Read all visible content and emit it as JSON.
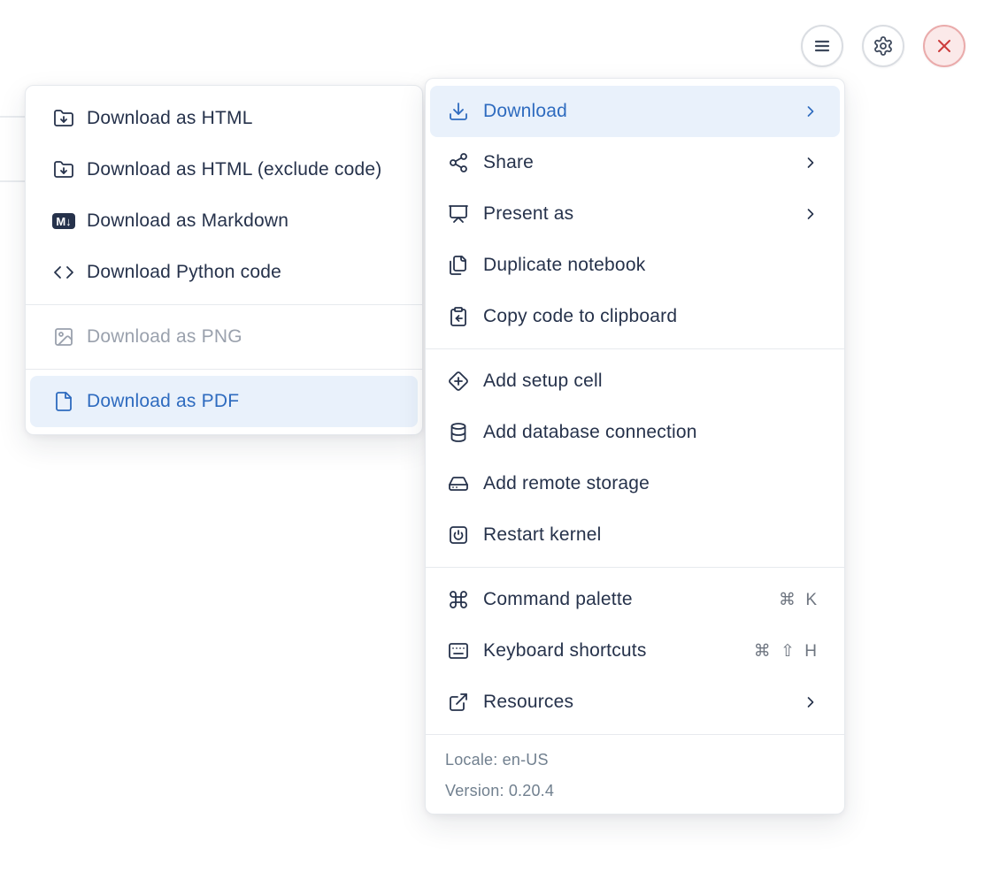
{
  "colors": {
    "accent_blue": "#2e6bbf",
    "highlight_bg": "#e9f1fb",
    "text_dark": "#26324b",
    "text_disabled": "#9aa1ad",
    "footer_text": "#71808f",
    "danger_red": "#cc3b3b",
    "danger_bg": "#fbe9e9"
  },
  "toolbar": {
    "buttons": [
      {
        "name": "menu",
        "icon": "hamburger-icon"
      },
      {
        "name": "settings",
        "icon": "gear-icon"
      },
      {
        "name": "shutdown",
        "icon": "close-icon"
      }
    ]
  },
  "download_submenu": {
    "items": [
      {
        "label": "Download as HTML",
        "icon": "folder-down",
        "state": "normal"
      },
      {
        "label": "Download as HTML (exclude code)",
        "icon": "folder-down",
        "state": "normal"
      },
      {
        "label": "Download as Markdown",
        "icon": "markdown-badge",
        "badge": "M↓",
        "state": "normal"
      },
      {
        "label": "Download Python code",
        "icon": "code",
        "state": "normal"
      },
      {
        "label": "Download as PNG",
        "icon": "image",
        "state": "disabled"
      },
      {
        "label": "Download as PDF",
        "icon": "file",
        "state": "highlighted"
      }
    ]
  },
  "main_menu": {
    "items": [
      {
        "label": "Download",
        "icon": "download",
        "submenu": true,
        "state": "highlighted"
      },
      {
        "label": "Share",
        "icon": "share",
        "submenu": true
      },
      {
        "label": "Present as",
        "icon": "presentation",
        "submenu": true
      },
      {
        "label": "Duplicate notebook",
        "icon": "files"
      },
      {
        "label": "Copy code to clipboard",
        "icon": "clipboard-copy"
      },
      {
        "label": "Add setup cell",
        "icon": "diamond-plus"
      },
      {
        "label": "Add database connection",
        "icon": "database"
      },
      {
        "label": "Add remote storage",
        "icon": "hard-drive"
      },
      {
        "label": "Restart kernel",
        "icon": "square-power"
      },
      {
        "label": "Command palette",
        "icon": "command",
        "shortcut": "⌘ K"
      },
      {
        "label": "Keyboard shortcuts",
        "icon": "keyboard",
        "shortcut": "⌘ ⇧ H"
      },
      {
        "label": "Resources",
        "icon": "external-link",
        "submenu": true
      }
    ],
    "footer": {
      "locale": "Locale: en-US",
      "version": "Version: 0.20.4"
    }
  }
}
